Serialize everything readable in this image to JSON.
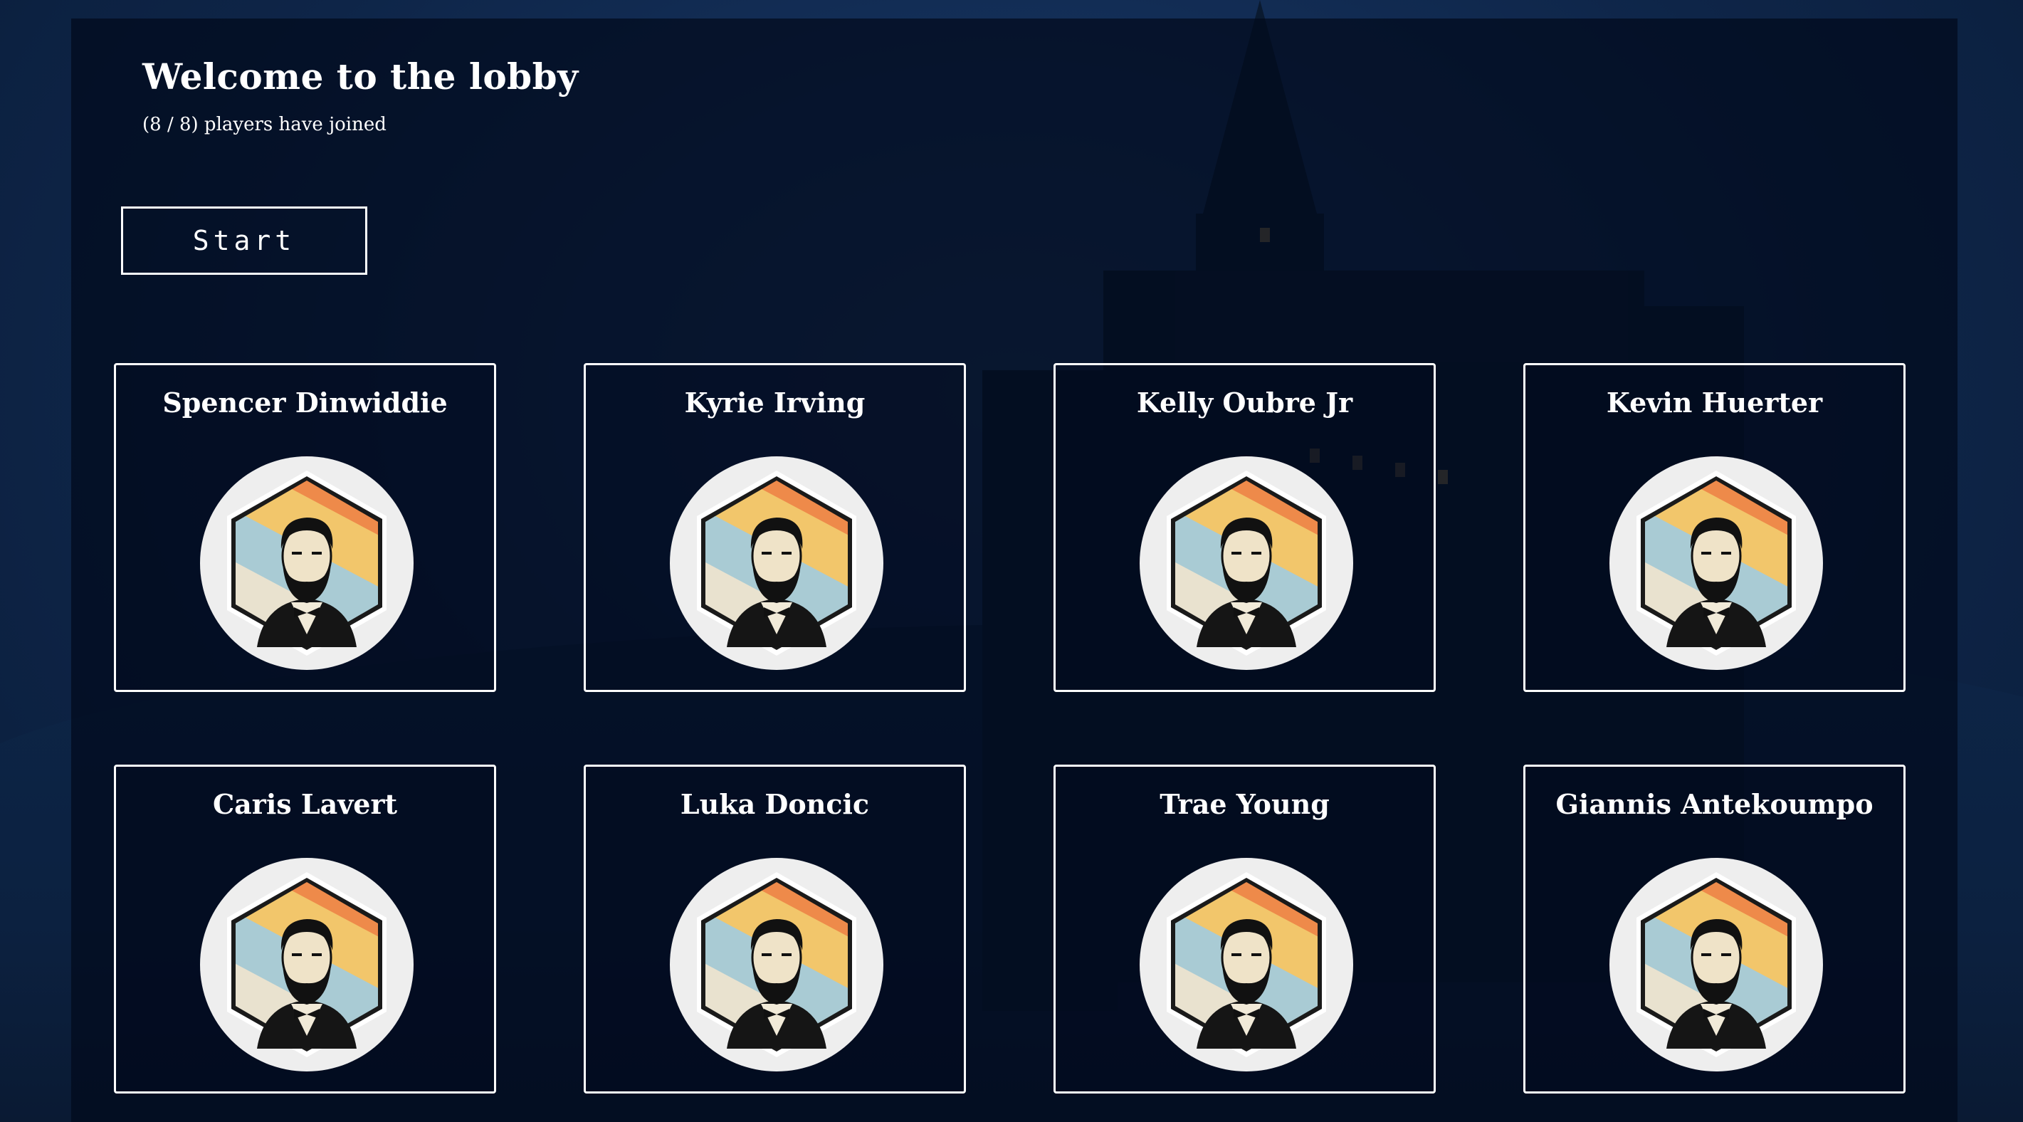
{
  "lobby": {
    "title": "Welcome to the lobby",
    "players_status": "(8 / 8) players have joined",
    "start_label": "Start"
  },
  "players": [
    {
      "name": "Spencer Dinwiddie",
      "avatar_icon": "lincoln-portrait-icon"
    },
    {
      "name": "Kyrie Irving",
      "avatar_icon": "lincoln-portrait-icon"
    },
    {
      "name": "Kelly Oubre Jr",
      "avatar_icon": "lincoln-portrait-icon"
    },
    {
      "name": "Kevin Huerter",
      "avatar_icon": "lincoln-portrait-icon"
    },
    {
      "name": "Caris Lavert",
      "avatar_icon": "lincoln-portrait-icon"
    },
    {
      "name": "Luka Doncic",
      "avatar_icon": "lincoln-portrait-icon"
    },
    {
      "name": "Trae Young",
      "avatar_icon": "lincoln-portrait-icon"
    },
    {
      "name": "Giannis Antekoumpo",
      "avatar_icon": "lincoln-portrait-icon"
    }
  ],
  "colors": {
    "panel": "#020a1c",
    "background": "#14305a",
    "text": "#ffffff",
    "avatar_stripes": [
      "#d9473a",
      "#ee8a4a",
      "#f2c66b",
      "#a9cbd4",
      "#e9e2cf"
    ]
  }
}
